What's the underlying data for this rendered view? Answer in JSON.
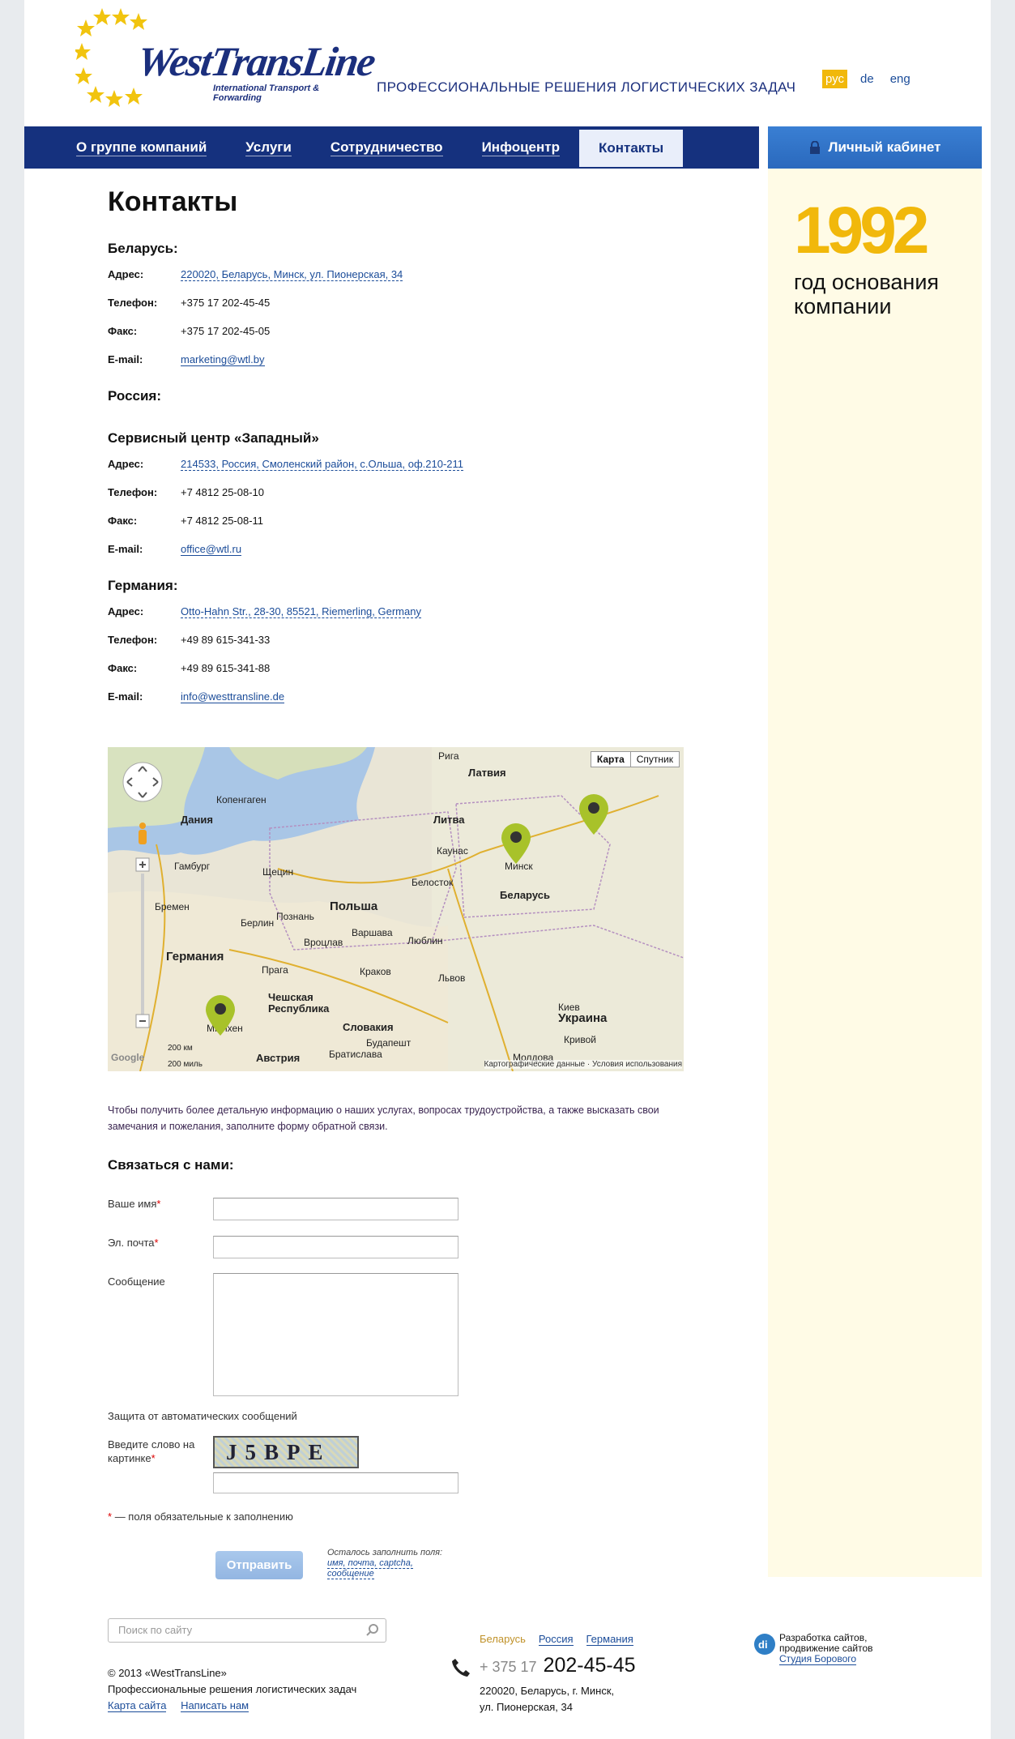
{
  "header": {
    "logo": "WestTransLine",
    "logo_sub": "International Transport & Forwarding",
    "tagline": "ПРОФЕССИОНАЛЬНЫЕ РЕШЕНИЯ ЛОГИСТИЧЕСКИХ ЗАДАЧ",
    "langs": [
      "рус",
      "de",
      "eng"
    ],
    "active_lang": "рус"
  },
  "nav": {
    "items": [
      "О группе компаний",
      "Услуги",
      "Сотрудничество",
      "Инфоцентр",
      "Контакты"
    ],
    "active": "Контакты",
    "cabinet": "Личный кабинет"
  },
  "sidebar": {
    "year": "1992",
    "caption": "год основания компании"
  },
  "page_title": "Контакты",
  "contacts": {
    "belarus": {
      "title": "Беларусь:",
      "address_label": "Адрес:",
      "address": "220020, Беларусь, Минск, ул. Пионерская, 34",
      "phone_label": "Телефон:",
      "phone": "+375 17 202-45-45",
      "fax_label": "Факс:",
      "fax": "+375 17 202-45-05",
      "email_label": "E-mail:",
      "email": "marketing@wtl.by"
    },
    "russia": {
      "title": "Россия:"
    },
    "service": {
      "title": "Сервисный центр «Западный»",
      "address_label": "Адрес:",
      "address": "214533, Россия, Смоленский район, с.Ольша, оф.210-211",
      "phone_label": "Телефон:",
      "phone": "+7 4812 25-08-10",
      "fax_label": "Факс:",
      "fax": "+7 4812 25-08-11",
      "email_label": "E-mail:",
      "email": "office@wtl.ru"
    },
    "germany": {
      "title": "Германия:",
      "address_label": "Адрес:",
      "address": "Otto-Hahn Str., 28-30, 85521, Riemerling, Germany",
      "phone_label": "Телефон:",
      "phone": "+49 89 615-341-33",
      "fax_label": "Факс:",
      "fax": "+49 89 615-341-88",
      "email_label": "E-mail:",
      "email": "info@westtransline.de"
    }
  },
  "map": {
    "btn_map": "Карта",
    "btn_sat": "Спутник",
    "footer": "Картографические данные · Условия использования",
    "labels": {
      "latvia": "Латвия",
      "riga": "Рига",
      "copenhagen": "Копенгаген",
      "denmark": "Дания",
      "lithuania": "Литва",
      "kaunas": "Каунас",
      "minsk": "Минск",
      "belarus": "Беларусь",
      "hamburg": "Гамбург",
      "szczecin": "Щецин",
      "poland": "Польша",
      "bialystok": "Белосток",
      "berlin": "Берлин",
      "poznan": "Познань",
      "warsaw": "Варшава",
      "lublin": "Люблин",
      "germany": "Германия",
      "wroclaw": "Вроцлав",
      "prague": "Прага",
      "krakow": "Краков",
      "lviv": "Львов",
      "kyiv": "Киев",
      "ukraine": "Украина",
      "czech": "Чешская Республика",
      "slovakia": "Словакия",
      "budapest": "Будапешт",
      "bratislava": "Братислава",
      "austria": "Австрия",
      "munich": "Мюнхен",
      "bremen": "Бремен",
      "kryvyi": "Кривой",
      "moldova": "Молдова",
      "scale_km": "200 км",
      "scale_mi": "200 миль",
      "google": "Google"
    }
  },
  "info_text": "Чтобы получить более детальную информацию о наших услугах, вопросах трудоустройства, а также высказать свои замечания и пожелания, заполните форму обратной связи.",
  "form": {
    "title": "Связаться с нами:",
    "name_label": "Ваше имя",
    "email_label": "Эл. почта",
    "message_label": "Сообщение",
    "protection": "Защита от автоматических сообщений",
    "captcha_label": "Введите слово на картинке",
    "captcha_text": "J5BPE",
    "required_note": "— поля обязательные к заполнению",
    "submit": "Отправить",
    "remain_prefix": "Осталось заполнить поля:",
    "remain_fields": "имя, почта, captcha, сообщение"
  },
  "footer": {
    "search_placeholder": "Поиск по сайту",
    "copyright": "© 2013 «WestTransLine»",
    "tagline": "Профессиональные решения логистических задач",
    "sitemap": "Карта сайта",
    "write_us": "Написать нам",
    "tabs": [
      "Беларусь",
      "Россия",
      "Германия"
    ],
    "phone_prefix": "+ 375 17",
    "phone_main": "202-45-45",
    "addr1": "220020, Беларусь, г. Минск,",
    "addr2": "ул. Пионерская, 34",
    "dev1": "Разработка сайтов,",
    "dev2": "продвижение сайтов",
    "dev3": "Студия Борового"
  },
  "colors": {
    "navy": "#15317e",
    "accent": "#f1b80b",
    "link": "#1b4c99",
    "sidebar_bg": "#fffbe6"
  }
}
